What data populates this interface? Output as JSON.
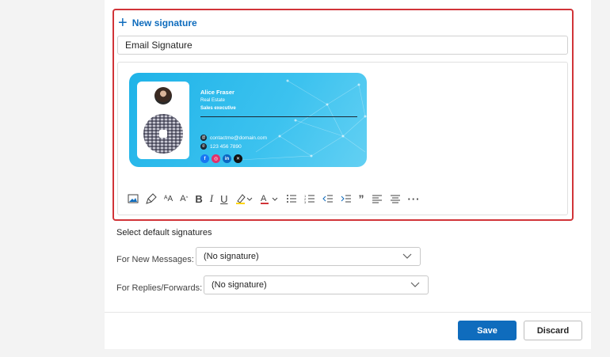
{
  "signature_editor": {
    "new_signature_label": "New signature",
    "name_value": "Email Signature",
    "card": {
      "name": "Alice Fraser",
      "company": "Real Estate",
      "title": "Sales executive",
      "email": "contactme@domain.com",
      "phone": "123 456 7890",
      "socials": [
        "facebook-icon",
        "instagram-icon",
        "linkedin-icon",
        "x-icon"
      ],
      "bg_color": "#2bb8ea"
    },
    "toolbar": [
      "insert-image-icon",
      "format-painter-icon",
      "font-size-icon",
      "increase-font-icon",
      "bold-icon",
      "italic-icon",
      "underline-icon",
      "highlight-icon",
      "font-color-icon",
      "bullets-icon",
      "numbering-icon",
      "decrease-indent-icon",
      "increase-indent-icon",
      "quote-icon",
      "align-left-icon",
      "align-center-icon",
      "more-options-icon"
    ]
  },
  "defaults": {
    "section_title": "Select default signatures",
    "new_messages_label": "For New Messages:",
    "new_messages_value": "(No signature)",
    "replies_label": "For Replies/Forwards:",
    "replies_value": "(No signature)"
  },
  "footer": {
    "save_label": "Save",
    "discard_label": "Discard"
  },
  "colors": {
    "accent": "#0f6cbd",
    "highlight_border": "#d13438"
  }
}
